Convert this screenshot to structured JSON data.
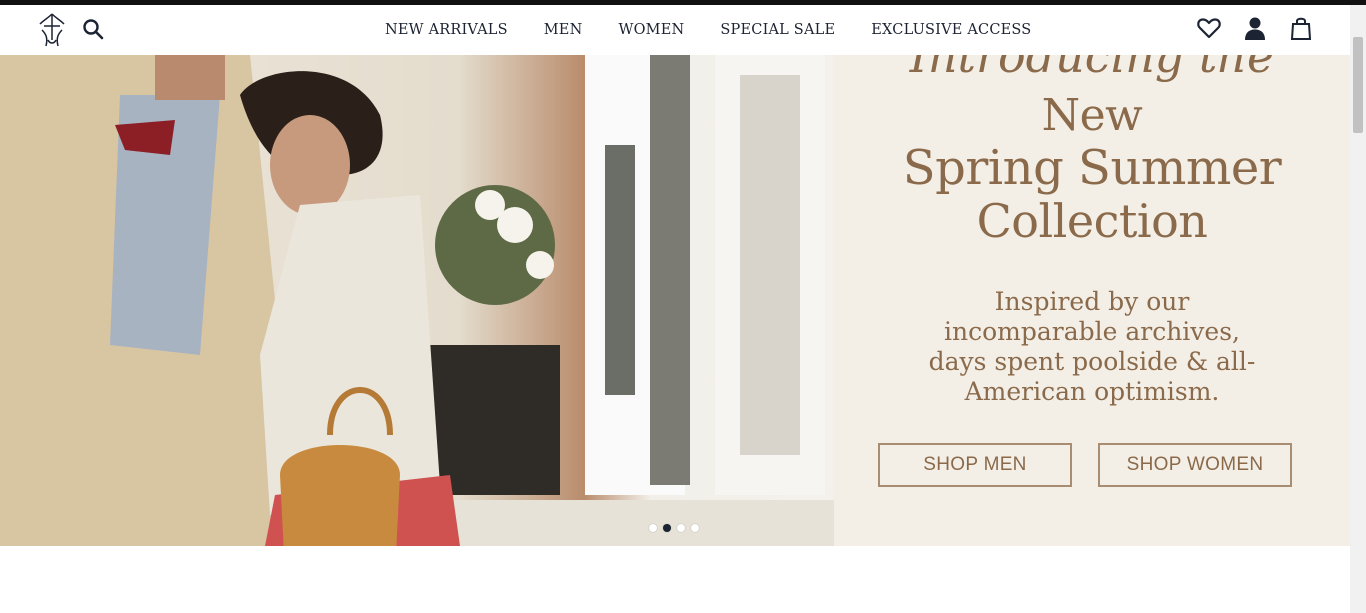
{
  "header": {
    "nav": [
      "NEW ARRIVALS",
      "MEN",
      "WOMEN",
      "SPECIAL SALE",
      "EXCLUSIVE ACCESS"
    ],
    "icons": [
      "search-icon",
      "heart-icon",
      "account-icon",
      "bag-icon"
    ]
  },
  "hero": {
    "kicker": "Introducing the",
    "headline": [
      "New",
      "Spring Summer",
      "Collection"
    ],
    "subcopy": "Inspired by our incomparable archives, days spent poolside & all-American optimism.",
    "buttons": {
      "men": "SHOP MEN",
      "women": "SHOP WOMEN"
    },
    "carousel": {
      "slides": 4,
      "active": 2
    }
  },
  "colors": {
    "brown": "#8a6a4a",
    "navy": "#1c2333",
    "cream": "#f3efe7"
  }
}
